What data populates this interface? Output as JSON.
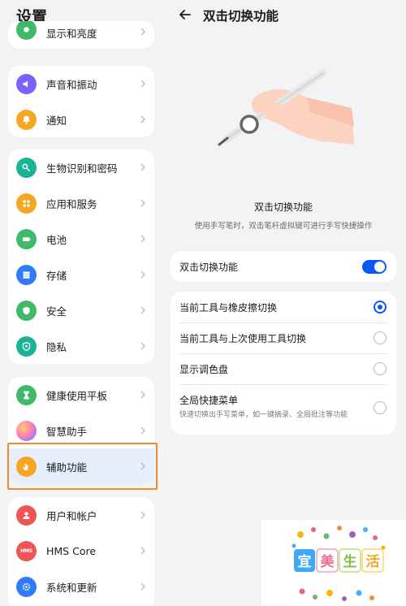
{
  "settings_title": "设置",
  "settings_groups": [
    {
      "items": [
        {
          "label": "显示和亮度",
          "icon": "brightness-icon",
          "color": "#3fba6a"
        }
      ]
    },
    {
      "items": [
        {
          "label": "声音和振动",
          "icon": "sound-icon",
          "color": "#7b61ff"
        },
        {
          "label": "通知",
          "icon": "bell-icon",
          "color": "#f5a623"
        }
      ]
    },
    {
      "items": [
        {
          "label": "生物识别和密码",
          "icon": "key-icon",
          "color": "#1ab394"
        },
        {
          "label": "应用和服务",
          "icon": "apps-icon",
          "color": "#f5a623"
        },
        {
          "label": "电池",
          "icon": "battery-icon",
          "color": "#3fba6a"
        },
        {
          "label": "存储",
          "icon": "storage-icon",
          "color": "#2f7cf6"
        },
        {
          "label": "安全",
          "icon": "shield-icon",
          "color": "#3fba6a"
        },
        {
          "label": "隐私",
          "icon": "privacy-icon",
          "color": "#1ab394"
        }
      ]
    },
    {
      "items": [
        {
          "label": "健康使用平板",
          "icon": "hourglass-icon",
          "color": "#3fba6a"
        },
        {
          "label": "智慧助手",
          "icon": "assistant-icon",
          "color": "#c77dff"
        },
        {
          "label": "辅助功能",
          "icon": "hand-icon",
          "color": "#f5a623",
          "selected": true
        }
      ]
    },
    {
      "items": [
        {
          "label": "用户和帐户",
          "icon": "user-icon",
          "color": "#f05454"
        },
        {
          "label": "HMS Core",
          "icon": "hms-icon",
          "color": "#f05454"
        },
        {
          "label": "系统和更新",
          "icon": "gear-icon",
          "color": "#2f7cf6"
        }
      ]
    }
  ],
  "hms_badge": "HMS",
  "detail": {
    "title": "双击切换功能",
    "feature_title": "双击切换功能",
    "feature_desc": "使用手写笔时，双击笔杆虚拟键可进行手写快捷操作",
    "toggle_label": "双击切换功能",
    "toggle_on": true,
    "options": [
      {
        "label": "当前工具与橡皮擦切换",
        "selected": true
      },
      {
        "label": "当前工具与上次使用工具切换",
        "selected": false
      },
      {
        "label": "显示调色盘",
        "selected": false
      },
      {
        "label": "全局快捷菜单",
        "sub": "快速切换出手写菜单，如一键摘录、全局批注等功能",
        "selected": false
      }
    ]
  },
  "accent_color": "#0a59f7",
  "highlight_color": "#f08a2c",
  "watermark": {
    "chars": [
      "宜",
      "美",
      "生",
      "活"
    ]
  }
}
